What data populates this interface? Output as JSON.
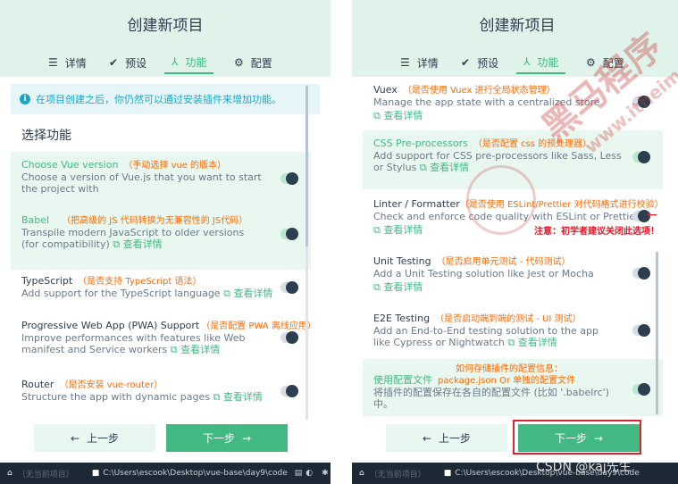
{
  "left": {
    "title": "创建新项目",
    "tabs": [
      "详情",
      "预设",
      "功能",
      "配置"
    ],
    "info": "在项目创建之后，你仍然可以通过安装插件来增加功能。",
    "section_title": "选择功能",
    "features": [
      {
        "name": "Choose Vue version",
        "note": "（手动选择 vue 的版本）",
        "desc": "Choose a version of Vue.js that you want to start the project with",
        "more": "",
        "enabled": true
      },
      {
        "name": "Babel",
        "note": "（把高级的 JS 代码转换为无兼容性的 JS代码）",
        "desc": "Transpile modern JavaScript to older versions (for compatibility)",
        "more": "查看详情",
        "enabled": true
      },
      {
        "name": "TypeScript",
        "note": "（是否支持 TypeScript 语法）",
        "desc": "Add support for the TypeScript language",
        "more": "查看详情",
        "enabled": false
      },
      {
        "name": "Progressive Web App (PWA) Support",
        "note": "（是否配置 PWA 离线应用）",
        "desc": "Improve performances with features like Web manifest and Service workers",
        "more": "查看详情",
        "enabled": false
      },
      {
        "name": "Router",
        "note": "（是否安装 vue-router）",
        "desc": "Structure the app with dynamic pages",
        "more": "查看详情",
        "enabled": false
      }
    ],
    "prev": "上一步",
    "next": "下一步",
    "status": {
      "project": "（无当前项目）",
      "path": "C:\\Users\\escook\\Desktop\\vue-base\\day9\\code"
    }
  },
  "right": {
    "title": "创建新项目",
    "tabs": [
      "详情",
      "预设",
      "功能",
      "配置"
    ],
    "features": [
      {
        "name": "Vuex",
        "note": "（是否使用 Vuex 进行全局状态管理）",
        "desc": "Manage the app state with a centralized store",
        "more": "查看详情",
        "enabled": false
      },
      {
        "name": "CSS Pre-processors",
        "note": "（是否配置 css 的预处理器）",
        "desc": "Add support for CSS pre-processors like Sass, Less or Stylus",
        "more": "查看详情",
        "enabled": true
      },
      {
        "name": "Linter / Formatter",
        "note": "（是否使用 ESLint/Prettier 对代码格式进行校验）",
        "desc": "Check and enforce code quality with ESLint or Prettier",
        "more": "查看详情",
        "enabled": false
      },
      {
        "name": "Unit Testing",
        "note": "（是否启用单元测试 - 代码测试）",
        "desc": "Add a Unit Testing solution like Jest or Mocha",
        "more": "查看详情",
        "enabled": false
      },
      {
        "name": "E2E Testing",
        "note": "（是否启动端到端的测试 - UI 测试）",
        "desc": "Add an End-to-End testing solution to the app like Cypress or Nightwatch",
        "more": "查看详情",
        "enabled": false
      }
    ],
    "config_note": "如何存储插件的配置信息：",
    "config_name": "使用配置文件",
    "config_name_note": "package.json Or 单独的配置文件",
    "config_desc": "将插件的配置保存在各自的配置文件 (比如 '.babelrc') 中。",
    "config_enabled": true,
    "lint_warning": "注意：初学者建议关闭此选项！",
    "prev": "上一步",
    "next": "下一步",
    "status": {
      "project": "（无当前项目）",
      "path": "C:\\Users\\escook\\Desktop\\vue-base\\day9\\code"
    }
  },
  "watermark": {
    "brand": "黑马程序",
    "url": "www.itheima",
    "credit": "CSDN @kaj先生"
  },
  "colors": {
    "accent": "#42b983",
    "note": "#ff6a00",
    "warn": "#e0192a",
    "header": "#dff3ea"
  }
}
